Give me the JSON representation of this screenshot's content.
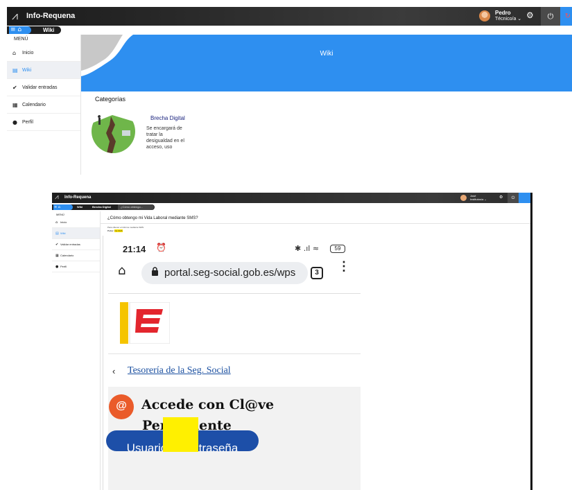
{
  "top": {
    "app_title": "Info-Requena",
    "user": {
      "name": "Pedro",
      "role": "Técnico/a ⌄"
    },
    "icons": {
      "logo": "logo-icon",
      "gear": "⚙",
      "power": "⏻",
      "notif": "↻"
    },
    "breadcrumb": {
      "menu": "≡",
      "home": "⌂",
      "current": "Wiki"
    },
    "sidebar": {
      "heading": "MENÚ",
      "items": [
        {
          "icon": "⌂",
          "label": "Inicio",
          "active": false
        },
        {
          "icon": "▤",
          "label": "Wiki",
          "active": true
        },
        {
          "icon": "✔",
          "label": "Validar entradas",
          "active": false
        },
        {
          "icon": "▦",
          "label": "Calendario",
          "active": false
        },
        {
          "icon": "●",
          "label": "Perfil",
          "active": false
        }
      ]
    },
    "hero_title": "Wiki",
    "categories_heading": "Categorías",
    "card": {
      "title": "Brecha Digital",
      "description": "Se encargará de tratar la desigualdad en el acceso, uso"
    }
  },
  "bottom": {
    "app_title": "Info-Requena",
    "user": {
      "name": "José",
      "role": "Institutos/a ⌄"
    },
    "breadcrumb": {
      "menu": "≡ ⌂",
      "wiki": "Wiki",
      "cat": "Brecha Digital",
      "current": "¿Cómo obtengo..."
    },
    "sidebar": {
      "heading": "MENÚ",
      "items": [
        {
          "icon": "⌂",
          "label": "Inicio",
          "active": false
        },
        {
          "icon": "▤",
          "label": "Wiki",
          "active": true
        },
        {
          "icon": "✔",
          "label": "Validar entradas",
          "active": false
        },
        {
          "icon": "▦",
          "label": "Calendario",
          "active": false
        },
        {
          "icon": "●",
          "label": "Perfil",
          "active": false
        }
      ]
    },
    "question_title": "¿Cómo obtengo mi Vida Laboral mediante SMS?",
    "note_line1": "Para obtener el informe mediante SMS:",
    "note_line2_prefix": "Pulsa: ",
    "note_line2_highlight": "Vía SMS",
    "phone": {
      "time": "21:14",
      "alarm": "⏰",
      "status": "✱ .ıl ≈",
      "battery": "59",
      "home_icon": "⌂",
      "lock_icon": "🔒",
      "url": "portal.seg-social.gob.es/wps",
      "tabs_count": "3",
      "menu_dots": "⋮",
      "back": "‹",
      "link": "Tesorería de la Seg. Social",
      "clave_icon": "@",
      "clave_line1": "Accede con Cl@ve",
      "clave_line2": "Permanente",
      "button_label": "Usuario y contraseña"
    }
  }
}
